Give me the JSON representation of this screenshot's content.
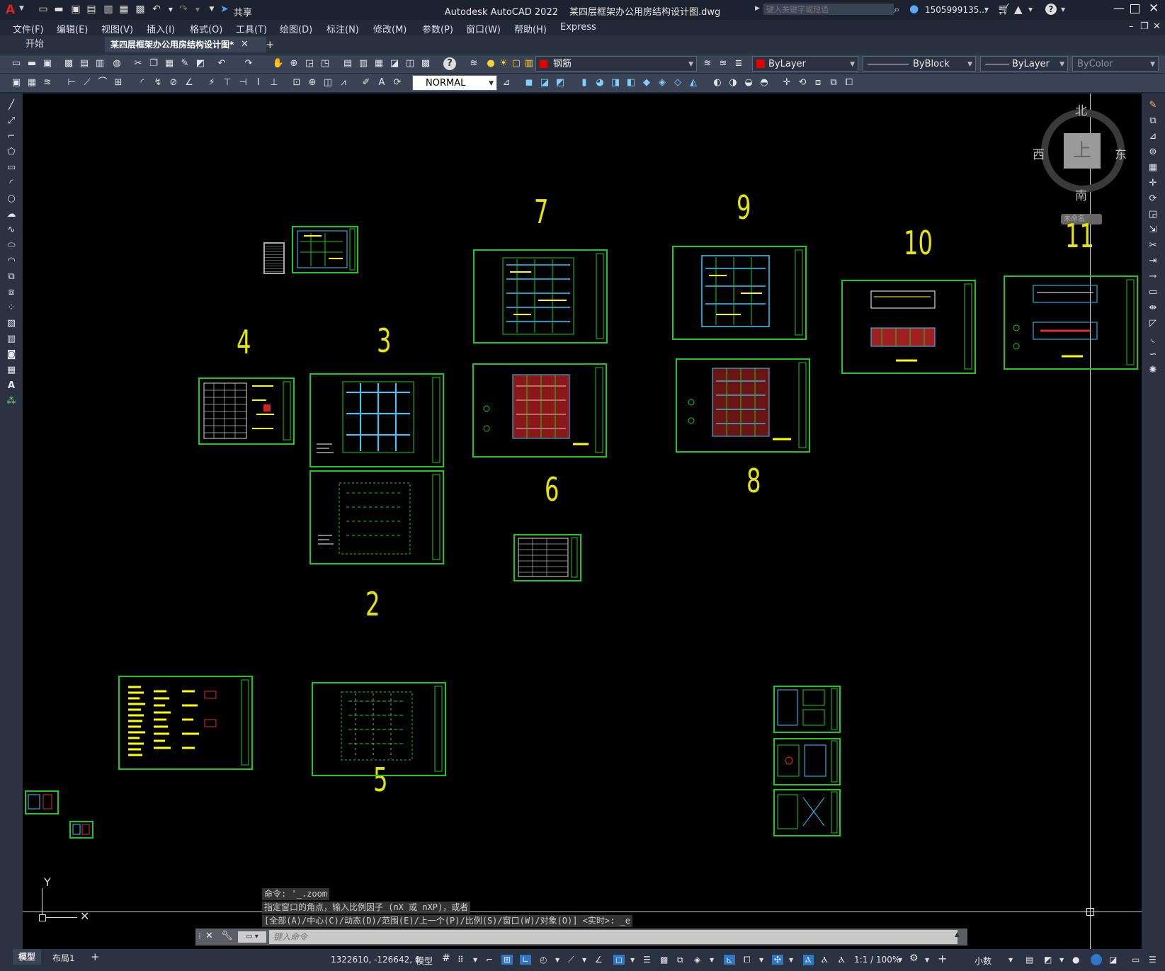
{
  "app": {
    "title": "Autodesk AutoCAD 2022",
    "document": "某四层框架办公用房结构设计图.dwg",
    "share_label": "共享"
  },
  "search": {
    "placeholder": "键入关键字或短语"
  },
  "account": {
    "user": "1505999135..."
  },
  "menu": [
    "文件(F)",
    "编辑(E)",
    "视图(V)",
    "插入(I)",
    "格式(O)",
    "工具(T)",
    "绘图(D)",
    "标注(N)",
    "修改(M)",
    "参数(P)",
    "窗口(W)",
    "帮助(H)",
    "Express"
  ],
  "tabs": [
    {
      "label": "开始"
    },
    {
      "label": "某四层框架办公用房结构设计图*"
    }
  ],
  "toolbar": {
    "layer": "钢筋",
    "color": "ByLayer",
    "linetype": "ByBlock",
    "lineweight": "ByLayer",
    "plotstyle": "ByColor",
    "textstyle": "NORMAL"
  },
  "colors": {
    "layer_swatch": "#e00000",
    "sheet_border": "#1ec81e",
    "number_color": "#e5e500",
    "canvas": "#000000"
  },
  "viewcube": {
    "north": "北",
    "south": "南",
    "east": "东",
    "west": "西",
    "top": "上",
    "wcs": "未命名"
  },
  "sheet_numbers": [
    "7",
    "9",
    "10",
    "11",
    "4",
    "3",
    "6",
    "8",
    "2",
    "5"
  ],
  "ucs": {
    "y": "Y"
  },
  "command": {
    "history1": "命令: '_.zoom",
    "history2": "指定窗口的角点，输入比例因子 (nX 或 nXP)，或者",
    "history3": "[全部(A)/中心(C)/动态(D)/范围(E)/上一个(P)/比例(S)/窗口(W)/对象(O)] <实时>: _e",
    "placeholder": "键入命令"
  },
  "layout_tabs": [
    {
      "label": "模型"
    },
    {
      "label": "布局1"
    }
  ],
  "status": {
    "coords": "1322610, -126642, 0",
    "model": "模型",
    "scale": "1:1 / 100%",
    "units": "小数"
  }
}
